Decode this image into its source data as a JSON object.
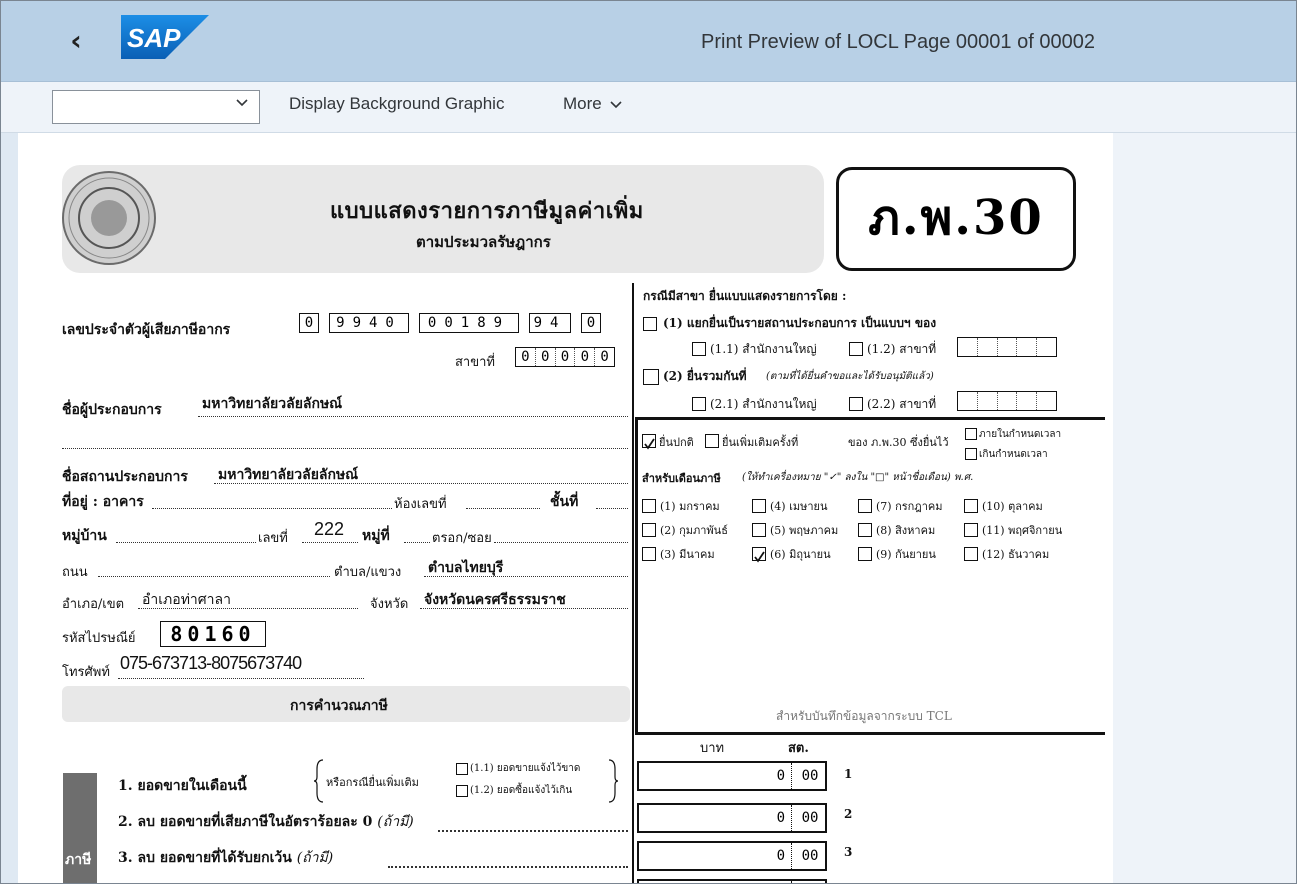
{
  "shell": {
    "back_icon": "chevron-left-icon",
    "logo_text": "SAP",
    "title": "Print Preview of LOCL Page 00001 of 00002",
    "brand_color": "#0a6ed1"
  },
  "toolbar": {
    "select_value": "",
    "display_bg_label": "Display Background Graphic",
    "more_label": "More"
  },
  "form": {
    "title": "แบบแสดงรายการภาษีมูลค่าเพิ่ม",
    "subtitle": "ตามประมวลรัษฎากร",
    "code": "ภ.พ.30",
    "taxid_label": "เลขประจำตัวผู้เสียภาษีอากร",
    "taxid_digits": [
      "0",
      "9940",
      "00189",
      "94",
      "0"
    ],
    "branch_label": "สาขาที่",
    "branch_digits": [
      "0",
      "0",
      "0",
      "0",
      "0"
    ],
    "operator_label": "ชื่อผู้ประกอบการ",
    "operator_value": "มหาวิทยาลัยวลัยลักษณ์",
    "establishment_label": "ชื่อสถานประกอบการ",
    "establishment_value": "มหาวิทยาลัยวลัยลักษณ์",
    "address_label": "ที่อยู่ : อาคาร",
    "room_label": "ห้องเลขที่",
    "floor_label": "ชั้นที่",
    "village_label": "หมู่บ้าน",
    "number_label": "เลขที่",
    "number_value": "222",
    "moo_label": "หมู่ที่",
    "soi_label": "ตรอก/ซอย",
    "road_label": "ถนน",
    "subdistrict_label": "ตำบล/แขวง",
    "subdistrict_value": "ตำบลไทยบุรี",
    "district_label": "อำเภอ/เขต",
    "district_value": "อำเภอท่าศาลา",
    "province_label": "จังหวัด",
    "province_value": "จังหวัดนครศรีธรรมราช",
    "postal_label": "รหัสไปรษณีย์",
    "postal_value": "80160",
    "phone_label": "โทรศัพท์",
    "phone_value": "075-673713-8075673740",
    "calc_label": "การคำนวณภาษี",
    "branch_section": {
      "heading": "กรณีมีสาขา ยื่นแบบแสดงรายการโดย :",
      "opt1": "(1) แยกยื่นเป็นรายสถานประกอบการ  เป็นแบบฯ ของ",
      "opt1_1": "(1.1) สำนักงานใหญ่",
      "opt1_2": "(1.2) สาขาที่",
      "opt2": "(2) ยื่นรวมกันที่",
      "opt2_note": "(ตามที่ได้ยื่นคำขอและได้รับอนุมัติแล้ว)",
      "opt2_1": "(2.1) สำนักงานใหญ่",
      "opt2_2": "(2.2) สาขาที่"
    },
    "filing": {
      "normal": "ยื่นปกติ",
      "additional": "ยื่นเพิ่มเติมครั้งที่",
      "of": "ของ ภ.พ.30 ซึ่งยื่นไว้",
      "within": "ภายในกำหนดเวลา",
      "over": "เกินกำหนดเวลา",
      "month_label": "สำหรับเดือนภาษี",
      "month_note": "(ให้ทำเครื่องหมาย \"✓\" ลงใน \"□\" หน้าชื่อเดือน) พ.ศ.",
      "months": [
        {
          "label": "(1) มกราคม",
          "checked": false
        },
        {
          "label": "(4) เมษายน",
          "checked": false
        },
        {
          "label": "(7) กรกฎาคม",
          "checked": false
        },
        {
          "label": "(10) ตุลาคม",
          "checked": false
        },
        {
          "label": "(2) กุมภาพันธ์",
          "checked": false
        },
        {
          "label": "(5) พฤษภาคม",
          "checked": false
        },
        {
          "label": "(8) สิงหาคม",
          "checked": false
        },
        {
          "label": "(11) พฤศจิกายน",
          "checked": false
        },
        {
          "label": "(3) มีนาคม",
          "checked": false
        },
        {
          "label": "(6) มิถุนายน",
          "checked": true
        },
        {
          "label": "(9) กันยายน",
          "checked": false
        },
        {
          "label": "(12) ธันวาคม",
          "checked": false
        }
      ],
      "tcl_note": "สำหรับบันทึกข้อมูลจากระบบ TCL"
    },
    "amount_headers": {
      "baht": "บาท",
      "satang": "สต."
    },
    "side_tab": "ภาษี",
    "lines": [
      {
        "label": "1. ยอดขายในเดือนนี้",
        "baht": "0",
        "satang": "00",
        "no": "1"
      },
      {
        "label": "2. ลบ ยอดขายที่เสียภาษีในอัตราร้อยละ 0",
        "note": "(ถ้ามี)",
        "baht": "0",
        "satang": "00",
        "no": "2"
      },
      {
        "label": "3. ลบ ยอดขายที่ได้รับยกเว้น",
        "note": "(ถ้ามี)",
        "baht": "0",
        "satang": "00",
        "no": "3"
      }
    ],
    "line1_extra": {
      "lead": "หรือกรณียื่นเพิ่มเติม",
      "a": "(1.1) ยอดขายแจ้งไว้ขาด",
      "b": "(1.2) ยอดซื้อแจ้งไว้เกิน"
    }
  }
}
